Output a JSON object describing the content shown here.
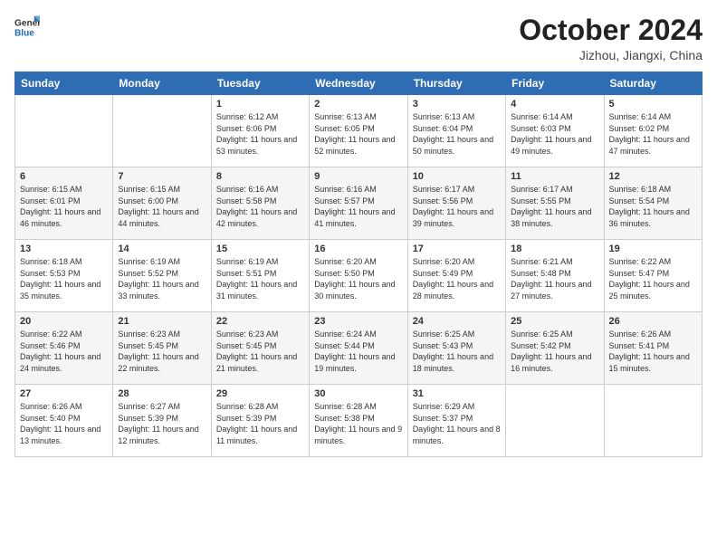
{
  "header": {
    "logo_general": "General",
    "logo_blue": "Blue",
    "month_title": "October 2024",
    "location": "Jizhou, Jiangxi, China"
  },
  "weekdays": [
    "Sunday",
    "Monday",
    "Tuesday",
    "Wednesday",
    "Thursday",
    "Friday",
    "Saturday"
  ],
  "weeks": [
    [
      {
        "day": "",
        "info": ""
      },
      {
        "day": "",
        "info": ""
      },
      {
        "day": "1",
        "info": "Sunrise: 6:12 AM\nSunset: 6:06 PM\nDaylight: 11 hours and 53 minutes."
      },
      {
        "day": "2",
        "info": "Sunrise: 6:13 AM\nSunset: 6:05 PM\nDaylight: 11 hours and 52 minutes."
      },
      {
        "day": "3",
        "info": "Sunrise: 6:13 AM\nSunset: 6:04 PM\nDaylight: 11 hours and 50 minutes."
      },
      {
        "day": "4",
        "info": "Sunrise: 6:14 AM\nSunset: 6:03 PM\nDaylight: 11 hours and 49 minutes."
      },
      {
        "day": "5",
        "info": "Sunrise: 6:14 AM\nSunset: 6:02 PM\nDaylight: 11 hours and 47 minutes."
      }
    ],
    [
      {
        "day": "6",
        "info": "Sunrise: 6:15 AM\nSunset: 6:01 PM\nDaylight: 11 hours and 46 minutes."
      },
      {
        "day": "7",
        "info": "Sunrise: 6:15 AM\nSunset: 6:00 PM\nDaylight: 11 hours and 44 minutes."
      },
      {
        "day": "8",
        "info": "Sunrise: 6:16 AM\nSunset: 5:58 PM\nDaylight: 11 hours and 42 minutes."
      },
      {
        "day": "9",
        "info": "Sunrise: 6:16 AM\nSunset: 5:57 PM\nDaylight: 11 hours and 41 minutes."
      },
      {
        "day": "10",
        "info": "Sunrise: 6:17 AM\nSunset: 5:56 PM\nDaylight: 11 hours and 39 minutes."
      },
      {
        "day": "11",
        "info": "Sunrise: 6:17 AM\nSunset: 5:55 PM\nDaylight: 11 hours and 38 minutes."
      },
      {
        "day": "12",
        "info": "Sunrise: 6:18 AM\nSunset: 5:54 PM\nDaylight: 11 hours and 36 minutes."
      }
    ],
    [
      {
        "day": "13",
        "info": "Sunrise: 6:18 AM\nSunset: 5:53 PM\nDaylight: 11 hours and 35 minutes."
      },
      {
        "day": "14",
        "info": "Sunrise: 6:19 AM\nSunset: 5:52 PM\nDaylight: 11 hours and 33 minutes."
      },
      {
        "day": "15",
        "info": "Sunrise: 6:19 AM\nSunset: 5:51 PM\nDaylight: 11 hours and 31 minutes."
      },
      {
        "day": "16",
        "info": "Sunrise: 6:20 AM\nSunset: 5:50 PM\nDaylight: 11 hours and 30 minutes."
      },
      {
        "day": "17",
        "info": "Sunrise: 6:20 AM\nSunset: 5:49 PM\nDaylight: 11 hours and 28 minutes."
      },
      {
        "day": "18",
        "info": "Sunrise: 6:21 AM\nSunset: 5:48 PM\nDaylight: 11 hours and 27 minutes."
      },
      {
        "day": "19",
        "info": "Sunrise: 6:22 AM\nSunset: 5:47 PM\nDaylight: 11 hours and 25 minutes."
      }
    ],
    [
      {
        "day": "20",
        "info": "Sunrise: 6:22 AM\nSunset: 5:46 PM\nDaylight: 11 hours and 24 minutes."
      },
      {
        "day": "21",
        "info": "Sunrise: 6:23 AM\nSunset: 5:45 PM\nDaylight: 11 hours and 22 minutes."
      },
      {
        "day": "22",
        "info": "Sunrise: 6:23 AM\nSunset: 5:45 PM\nDaylight: 11 hours and 21 minutes."
      },
      {
        "day": "23",
        "info": "Sunrise: 6:24 AM\nSunset: 5:44 PM\nDaylight: 11 hours and 19 minutes."
      },
      {
        "day": "24",
        "info": "Sunrise: 6:25 AM\nSunset: 5:43 PM\nDaylight: 11 hours and 18 minutes."
      },
      {
        "day": "25",
        "info": "Sunrise: 6:25 AM\nSunset: 5:42 PM\nDaylight: 11 hours and 16 minutes."
      },
      {
        "day": "26",
        "info": "Sunrise: 6:26 AM\nSunset: 5:41 PM\nDaylight: 11 hours and 15 minutes."
      }
    ],
    [
      {
        "day": "27",
        "info": "Sunrise: 6:26 AM\nSunset: 5:40 PM\nDaylight: 11 hours and 13 minutes."
      },
      {
        "day": "28",
        "info": "Sunrise: 6:27 AM\nSunset: 5:39 PM\nDaylight: 11 hours and 12 minutes."
      },
      {
        "day": "29",
        "info": "Sunrise: 6:28 AM\nSunset: 5:39 PM\nDaylight: 11 hours and 11 minutes."
      },
      {
        "day": "30",
        "info": "Sunrise: 6:28 AM\nSunset: 5:38 PM\nDaylight: 11 hours and 9 minutes."
      },
      {
        "day": "31",
        "info": "Sunrise: 6:29 AM\nSunset: 5:37 PM\nDaylight: 11 hours and 8 minutes."
      },
      {
        "day": "",
        "info": ""
      },
      {
        "day": "",
        "info": ""
      }
    ]
  ]
}
